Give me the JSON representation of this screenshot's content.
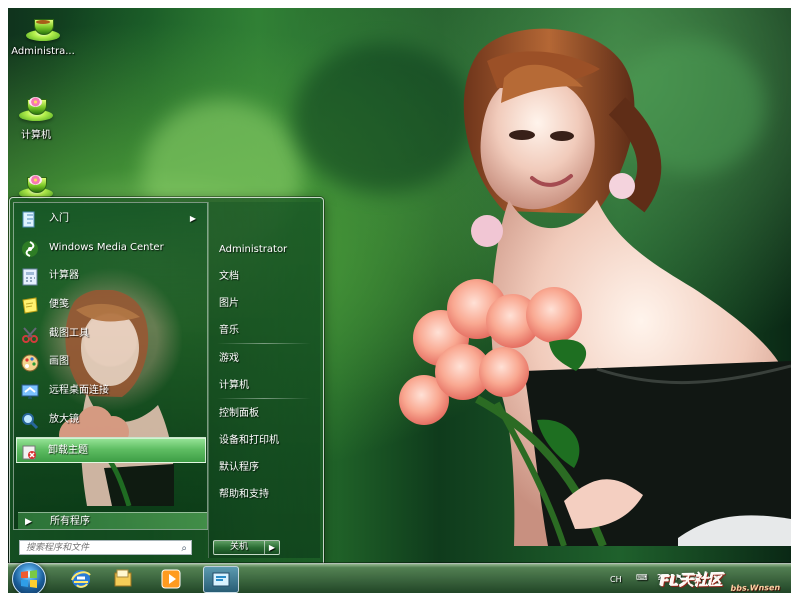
{
  "desktop": {
    "icons": [
      {
        "label": "Administra...",
        "icon": "green-teacup-icon"
      },
      {
        "label": "计算机",
        "icon": "flower-teacup-icon"
      },
      {
        "label": "",
        "icon": "pink-flower-teacup-icon"
      }
    ],
    "colors": {
      "background": "#1f612c",
      "accent": "#5ebd62",
      "menu": "#2b6e34"
    }
  },
  "start_menu": {
    "left_items": [
      {
        "label": "入门",
        "icon": "getting-started-icon",
        "has_submenu": true
      },
      {
        "label": "Windows Media Center",
        "icon": "media-center-icon",
        "has_submenu": false
      },
      {
        "label": "计算器",
        "icon": "calculator-icon",
        "has_submenu": false
      },
      {
        "label": "便笺",
        "icon": "sticky-notes-icon",
        "has_submenu": false
      },
      {
        "label": "截图工具",
        "icon": "snipping-tool-icon",
        "has_submenu": false
      },
      {
        "label": "画图",
        "icon": "paint-icon",
        "has_submenu": false
      },
      {
        "label": "远程桌面连接",
        "icon": "remote-desktop-icon",
        "has_submenu": false
      },
      {
        "label": "放大镜",
        "icon": "magnifier-icon",
        "has_submenu": false
      },
      {
        "label": "卸载主题",
        "icon": "uninstall-theme-icon",
        "has_submenu": false,
        "selected": true
      }
    ],
    "all_programs": "所有程序",
    "search_placeholder": "搜索程序和文件",
    "right_items": [
      "Administrator",
      "文档",
      "图片",
      "音乐",
      "游戏",
      "计算机",
      "控制面板",
      "设备和打印机",
      "默认程序",
      "帮助和支持"
    ],
    "shutdown_label": "关机"
  },
  "taskbar": {
    "buttons": [
      "start-orb-icon",
      "internet-explorer-icon",
      "file-explorer-icon",
      "media-player-icon",
      "active-window-icon"
    ],
    "tray": {
      "language": "CH",
      "icons": [
        "keyboard-icon",
        "help-icon",
        "flag-icon",
        "network-icon",
        "speaker-icon"
      ]
    }
  },
  "watermark": {
    "main": "FL天社区",
    "site": "bbs.Wnsen"
  }
}
